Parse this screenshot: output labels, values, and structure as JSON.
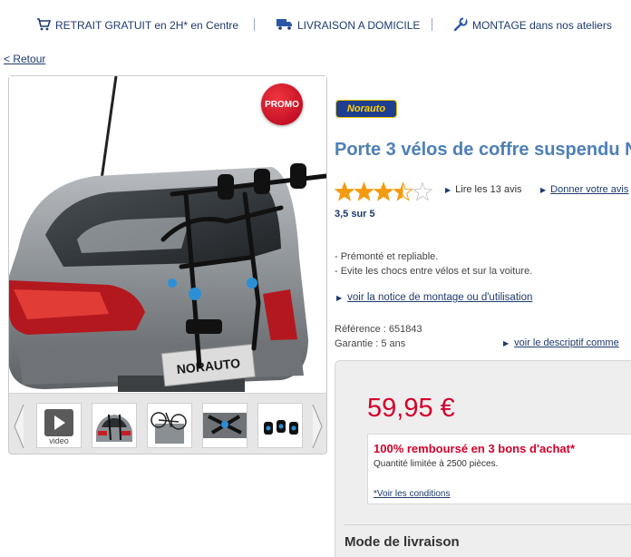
{
  "header": {
    "services": [
      {
        "label": "RETRAIT GRATUIT en 2H* en Centre",
        "icon": "cart-icon"
      },
      {
        "label": "LIVRAISON A DOMICILE",
        "icon": "truck-icon"
      },
      {
        "label": "MONTAGE dans nos ateliers",
        "icon": "wrench-icon"
      }
    ]
  },
  "nav": {
    "back": "< Retour"
  },
  "gallery": {
    "promo_badge": "PROMO",
    "product_plate_text": "NORAUTO",
    "thumbnails": [
      {
        "label": "video"
      },
      {
        "label": ""
      },
      {
        "label": ""
      },
      {
        "label": ""
      },
      {
        "label": ""
      }
    ]
  },
  "product": {
    "brand": "Norauto",
    "title": "Porte 3 vélos de coffre suspendu N",
    "rating": {
      "stars": 3.5,
      "max": 5,
      "score_text": "3,5 sur 5",
      "read_reviews": "Lire les 13 avis",
      "give_review": "Donner votre avis"
    },
    "features": [
      "- Prémonté et repliable.",
      "- Evite les chocs entre vélos et sur la voiture."
    ],
    "notice_link": "voir la notice de montage ou d'utilisation",
    "reference": "Référence : 651843",
    "guarantee": "Garantie : 5 ans",
    "description_link": "voir le descriptif comme"
  },
  "pricing": {
    "price": "59,95 €",
    "offer_title": "100% remboursé en 3 bons d'achat*",
    "offer_sub": "Quantité limitée à 2500 pièces.",
    "offer_conditions": "*Voir les conditions",
    "delivery_heading": "Mode de livraison"
  },
  "colors": {
    "title_blue": "#4d7fb8",
    "link_navy": "#1d3a6e",
    "price_red": "#d4002a",
    "star_orange": "#f39c12"
  }
}
